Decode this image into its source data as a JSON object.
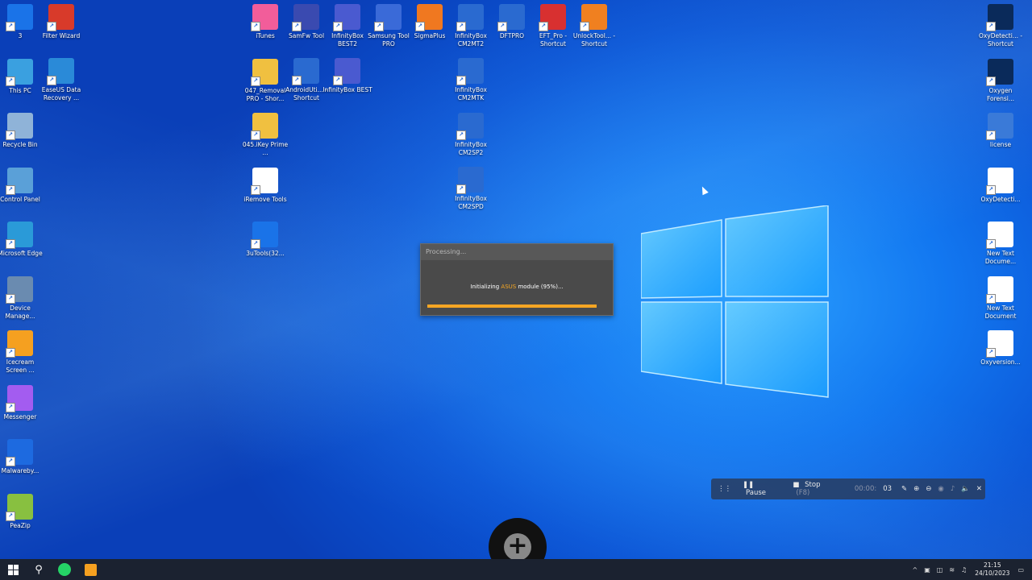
{
  "desktop": {
    "icons_left": [
      {
        "label": "3",
        "name": "3utools-icon",
        "color": "#1a73e8"
      },
      {
        "label": "This PC",
        "name": "this-pc-icon",
        "color": "#3aa0e0"
      },
      {
        "label": "Recycle Bin",
        "name": "recycle-bin-icon",
        "color": "#8fb3d8"
      },
      {
        "label": "Control Panel",
        "name": "control-panel-icon",
        "color": "#5aa0d8"
      },
      {
        "label": "Microsoft Edge",
        "name": "edge-icon",
        "color": "#2a9ad8"
      },
      {
        "label": "Device Manage...",
        "name": "device-manager-icon",
        "color": "#6a8bb0"
      },
      {
        "label": "Icecream Screen ...",
        "name": "icecream-icon",
        "color": "#f5a020"
      },
      {
        "label": "Messenger",
        "name": "messenger-icon",
        "color": "#a35cf0"
      },
      {
        "label": "Malwareby...",
        "name": "malwarebytes-icon",
        "color": "#1d6ae0"
      },
      {
        "label": "PeaZip",
        "name": "peazip-icon",
        "color": "#88c040"
      }
    ],
    "icons_col2": [
      {
        "label": "Filter Wizard",
        "name": "filter-wizard-icon",
        "color": "#d83a2a"
      },
      {
        "label": "EaseUS Data Recovery ...",
        "name": "easeus-icon",
        "color": "#2a8ad8"
      }
    ],
    "icons_col3": [
      {
        "label": "iTunes",
        "name": "itunes-icon",
        "color": "#f25d9a"
      },
      {
        "label": "047_Removal PRO - Shor...",
        "name": "folder-icon",
        "color": "#f0c040"
      },
      {
        "label": "045.iKey Prime ...",
        "name": "folder-icon",
        "color": "#f0c040"
      },
      {
        "label": "iRemove Tools",
        "name": "iremove-icon",
        "color": "#ffffff"
      },
      {
        "label": "3uTools(32...",
        "name": "3utools-icon",
        "color": "#1a73e8"
      }
    ],
    "icons_col4": [
      {
        "label": "SamFw Tool",
        "name": "samfw-icon",
        "color": "#3a4ab0"
      },
      {
        "label": "AndroidUti... - Shortcut",
        "name": "android-utility-icon",
        "color": "#2a6ad0"
      }
    ],
    "icons_col5": [
      {
        "label": "InfinityBox BEST2",
        "name": "infinitybox-icon",
        "color": "#4a5ad0"
      },
      {
        "label": "InfinityBox BEST",
        "name": "infinitybox-icon",
        "color": "#4a5ad0"
      }
    ],
    "icons_top_row": [
      {
        "label": "Samsung Tool PRO",
        "name": "samsung-tool-icon",
        "color": "#3a6ad8"
      },
      {
        "label": "SigmaPlus",
        "name": "sigmaplus-icon",
        "color": "#f07820"
      },
      {
        "label": "InfinityBox CM2MT2",
        "name": "infinitybox-cm2-icon",
        "color": "#2a6ad0"
      },
      {
        "label": "DFTPRO",
        "name": "dftpro-icon",
        "color": "#2a6ad0"
      },
      {
        "label": "EFT_Pro - Shortcut",
        "name": "eft-pro-icon",
        "color": "#d83030"
      },
      {
        "label": "UnlockTool... - Shortcut",
        "name": "unlocktool-icon",
        "color": "#f08020"
      }
    ],
    "icons_cm2_col": [
      {
        "label": "InfinityBox CM2MTK",
        "name": "infinitybox-cm2-icon",
        "color": "#2a6ad0"
      },
      {
        "label": "InfinityBox CM2SP2",
        "name": "infinitybox-cm2-icon",
        "color": "#2a6ad0"
      },
      {
        "label": "InfinityBox CM2SPD",
        "name": "infinitybox-cm2-icon",
        "color": "#2a6ad0"
      }
    ],
    "icons_right": [
      {
        "label": "OxyDetecti... - Shortcut",
        "name": "oxygen-icon",
        "color": "#0a2a5a"
      },
      {
        "label": "Oxygen Forensi...",
        "name": "oxygen-icon",
        "color": "#0a2a5a"
      },
      {
        "label": "license",
        "name": "license-file-icon",
        "color": "#3a7ad8"
      },
      {
        "label": "OxyDetecti...",
        "name": "file-icon",
        "color": "#ffffff"
      },
      {
        "label": "New Text Docume...",
        "name": "text-file-icon",
        "color": "#ffffff"
      },
      {
        "label": "New Text Document",
        "name": "text-file-icon",
        "color": "#ffffff"
      },
      {
        "label": "Oxyversion...",
        "name": "file-icon",
        "color": "#ffffff"
      }
    ]
  },
  "dialog": {
    "title": "Processing...",
    "message_prefix": "Initializing ",
    "message_highlight": "ASUS",
    "message_suffix": " module (95%)...",
    "progress": 1.0
  },
  "recorder": {
    "pause_label": "Pause",
    "stop_label": "Stop",
    "stop_key": "(F8)",
    "time_dim": "00:00:",
    "time_bright": "03"
  },
  "taskbar": {
    "time": "21:15",
    "date": "24/10/2023"
  },
  "colors": {
    "accent": "#f5a623",
    "taskbar": "#1b2230"
  }
}
